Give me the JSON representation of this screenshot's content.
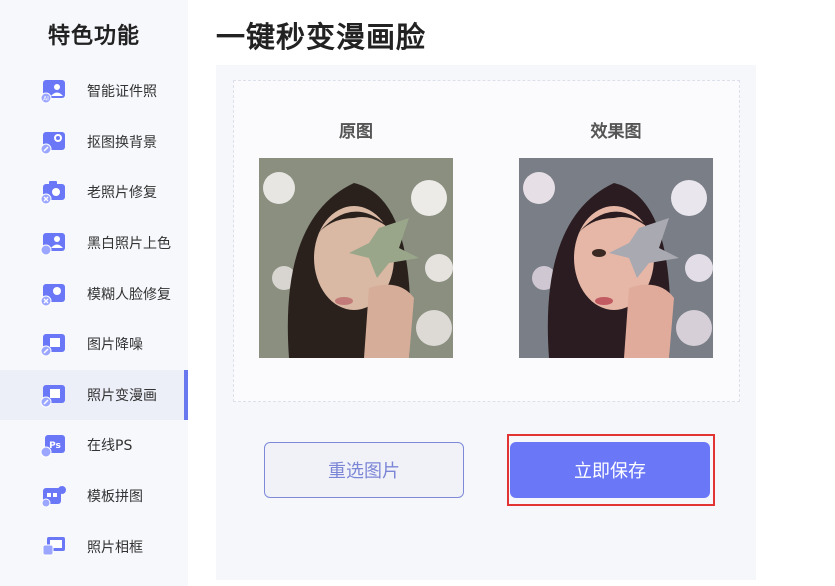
{
  "sidebar": {
    "title": "特色功能",
    "items": [
      {
        "label": "智能证件照",
        "icon": "id-photo-icon",
        "active": false
      },
      {
        "label": "抠图换背景",
        "icon": "cutout-background-icon",
        "active": false
      },
      {
        "label": "老照片修复",
        "icon": "old-photo-repair-icon",
        "active": false
      },
      {
        "label": "黑白照片上色",
        "icon": "colorize-photo-icon",
        "active": false
      },
      {
        "label": "模糊人脸修复",
        "icon": "face-repair-icon",
        "active": false
      },
      {
        "label": "图片降噪",
        "icon": "denoise-icon",
        "active": false
      },
      {
        "label": "照片变漫画",
        "icon": "photo-to-comic-icon",
        "active": true
      },
      {
        "label": "在线PS",
        "icon": "online-ps-icon",
        "active": false
      },
      {
        "label": "模板拼图",
        "icon": "template-collage-icon",
        "active": false
      },
      {
        "label": "照片相框",
        "icon": "photo-frame-icon",
        "active": false
      }
    ]
  },
  "main": {
    "title": "一键秒变漫画脸",
    "original_label": "原图",
    "result_label": "效果图",
    "reselect_button": "重选图片",
    "save_button": "立即保存"
  },
  "colors": {
    "accent": "#6a78f8",
    "highlight_border": "#e33434",
    "sidebar_bg": "#f7f8fc"
  }
}
